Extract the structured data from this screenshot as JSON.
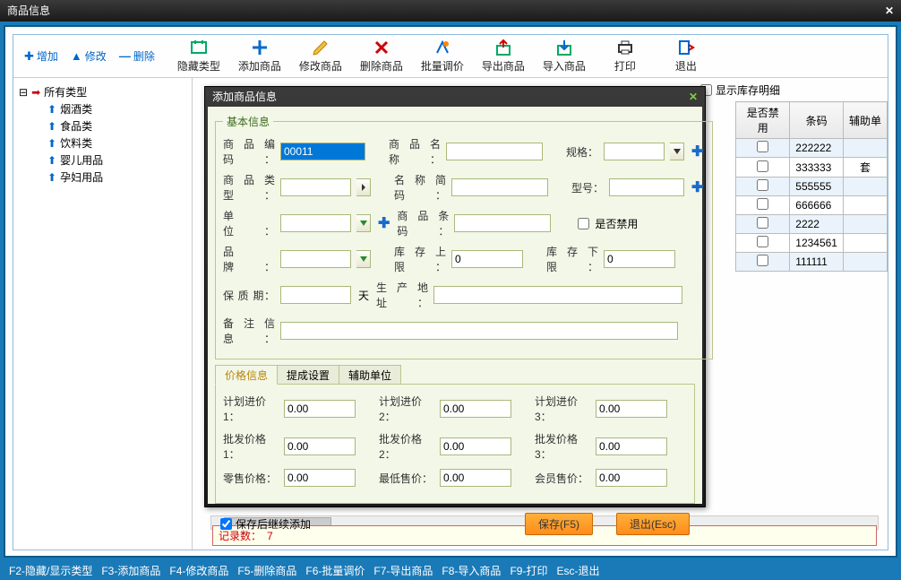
{
  "title": "商品信息",
  "leftButtons": {
    "add": "增加",
    "edit": "修改",
    "del": "删除"
  },
  "toolbar": [
    {
      "label": "隐藏类型"
    },
    {
      "label": "添加商品"
    },
    {
      "label": "修改商品"
    },
    {
      "label": "删除商品"
    },
    {
      "label": "批量调价"
    },
    {
      "label": "导出商品"
    },
    {
      "label": "导入商品"
    },
    {
      "label": "打印"
    },
    {
      "label": "退出"
    }
  ],
  "tree": {
    "root": "所有类型",
    "children": [
      "烟酒类",
      "食品类",
      "饮料类",
      "婴儿用品",
      "孕妇用品"
    ]
  },
  "gridTop": {
    "showStock": "显示库存明细"
  },
  "gridHeaders": [
    "是否禁用",
    "条码",
    "辅助单"
  ],
  "gridRows": [
    {
      "barcode": "222222",
      "aux": ""
    },
    {
      "barcode": "333333",
      "aux": "套"
    },
    {
      "barcode": "555555",
      "aux": ""
    },
    {
      "barcode": "666666",
      "aux": ""
    },
    {
      "barcode": "2222",
      "aux": ""
    },
    {
      "barcode": "1234561",
      "aux": ""
    },
    {
      "barcode": "111111",
      "aux": ""
    }
  ],
  "recordLabel": "记录数：",
  "recordCount": "7",
  "dialog": {
    "title": "添加商品信息",
    "fs1": "基本信息",
    "labels": {
      "code": "商品编码：",
      "name": "商品名称：",
      "spec": "规格：",
      "type": "商品类型：",
      "shortname": "名称简码：",
      "model": "型号：",
      "unit": "单　　位：",
      "barcode": "商品条码：",
      "disabled": "是否禁用",
      "brand": "品　　牌：",
      "stockup": "库存上限：",
      "stockdown": "库存下限：",
      "shelf": "保 质 期：",
      "day": "天",
      "origin": "生产地址：",
      "remark": "备注信息："
    },
    "values": {
      "code": "00011",
      "stockup": "0",
      "stockdown": "0"
    },
    "tabs": [
      "价格信息",
      "提成设置",
      "辅助单位"
    ],
    "priceLabels": {
      "planIn1": "计划进价1：",
      "planIn2": "计划进价2：",
      "planIn3": "计划进价3：",
      "whole1": "批发价格1：",
      "whole2": "批发价格2：",
      "whole3": "批发价格3：",
      "retail": "零售价格：",
      "minSell": "最低售价：",
      "member": "会员售价："
    },
    "priceValues": {
      "planIn1": "0.00",
      "planIn2": "0.00",
      "planIn3": "0.00",
      "whole1": "0.00",
      "whole2": "0.00",
      "whole3": "0.00",
      "retail": "0.00",
      "minSell": "0.00",
      "member": "0.00"
    },
    "keepAdding": "保存后继续添加",
    "btnSave": "保存(F5)",
    "btnExit": "退出(Esc)"
  },
  "status": [
    "F2-隐藏/显示类型",
    "F3-添加商品",
    "F4-修改商品",
    "F5-删除商品",
    "F6-批量调价",
    "F7-导出商品",
    "F8-导入商品",
    "F9-打印",
    "Esc-退出"
  ]
}
